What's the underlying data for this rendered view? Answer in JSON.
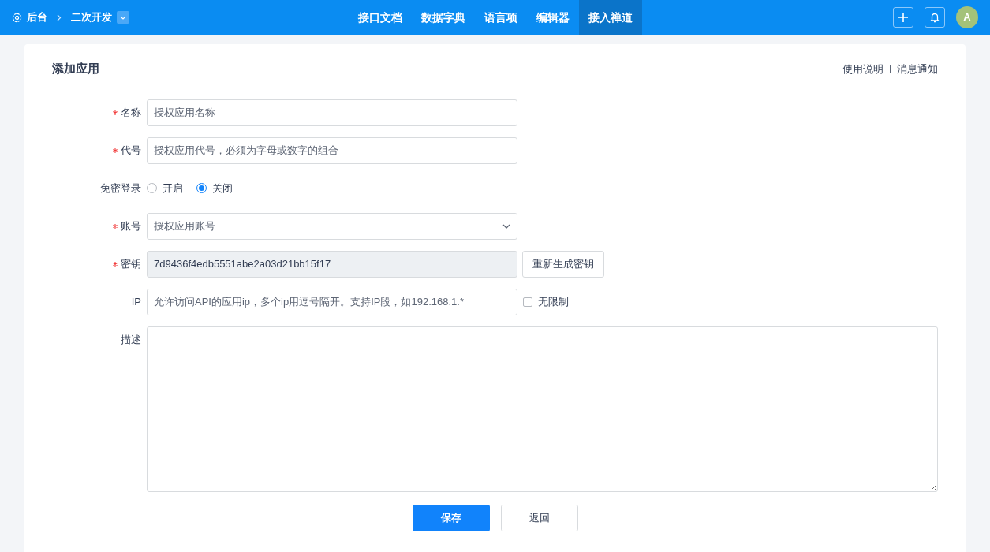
{
  "topbar": {
    "home": "后台",
    "project": "二次开发",
    "avatar": "A"
  },
  "nav": [
    {
      "label": "接口文档",
      "selected": false
    },
    {
      "label": "数据字典",
      "selected": false
    },
    {
      "label": "语言项",
      "selected": false
    },
    {
      "label": "编辑器",
      "selected": false
    },
    {
      "label": "接入禅道",
      "selected": true
    }
  ],
  "page": {
    "title": "添加应用",
    "links": [
      "使用说明",
      "消息通知"
    ]
  },
  "fields": [
    {
      "kind": "text",
      "label": "名称",
      "required": true,
      "placeholder": "授权应用名称"
    },
    {
      "kind": "text",
      "label": "代号",
      "required": true,
      "placeholder": "授权应用代号，必须为字母或数字的组合"
    },
    {
      "kind": "radio",
      "label": "免密登录",
      "required": false,
      "options": [
        {
          "label": "开启",
          "selected": false
        },
        {
          "label": "关闭",
          "selected": true
        }
      ]
    },
    {
      "kind": "select",
      "label": "账号",
      "required": true,
      "placeholder": "授权应用账号"
    },
    {
      "kind": "readonly",
      "label": "密钥",
      "required": true,
      "value": "7d9436f4edb5551abe2a03d21bb15f17",
      "button": "重新生成密钥"
    },
    {
      "kind": "ip",
      "label": "IP",
      "required": false,
      "placeholder": "允许访问API的应用ip，多个ip用逗号隔开。支持IP段，如192.168.1.*",
      "checkbox": {
        "label": "无限制",
        "checked": false
      }
    },
    {
      "kind": "textarea",
      "label": "描述",
      "required": false
    }
  ],
  "buttons": [
    {
      "label": "保存",
      "kind": "primary"
    },
    {
      "label": "返回",
      "kind": "default"
    }
  ]
}
